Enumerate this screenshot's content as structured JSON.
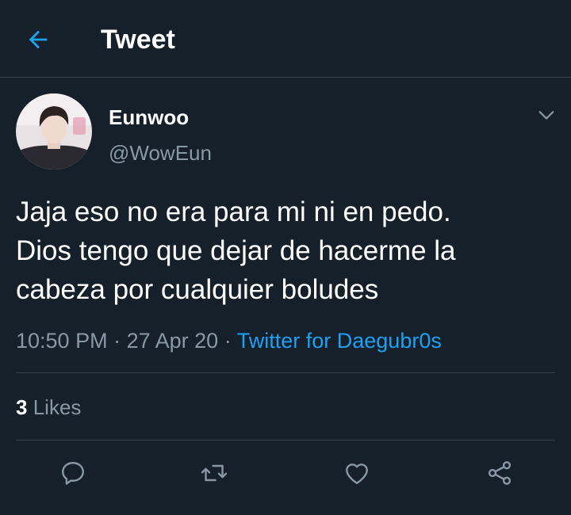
{
  "header": {
    "title": "Tweet",
    "back_icon": "arrow-left-icon",
    "accent_color": "#1da1f2"
  },
  "tweet": {
    "author": {
      "display_name": "Eunwoo",
      "handle": "@WowEun"
    },
    "text": "Jaja eso no era para mi ni en pedo.\nDios tengo que dejar de hacerme la\ncabeza por cualquier boludes",
    "time": "10:50 PM",
    "date": "27 Apr 20",
    "separator": "·",
    "source": "Twitter for Daegubr0s",
    "stats": {
      "likes_count": "3",
      "likes_label": "Likes"
    },
    "actions": [
      {
        "name": "reply",
        "icon": "speech-bubble-icon"
      },
      {
        "name": "retweet",
        "icon": "retweet-arrows-icon"
      },
      {
        "name": "like",
        "icon": "heart-icon"
      },
      {
        "name": "share",
        "icon": "share-nodes-icon"
      }
    ]
  },
  "colors": {
    "background": "#15202b",
    "divider": "#38444d",
    "secondary_text": "#8899a6",
    "primary_text": "#ffffff",
    "link": "#1da1f2"
  }
}
